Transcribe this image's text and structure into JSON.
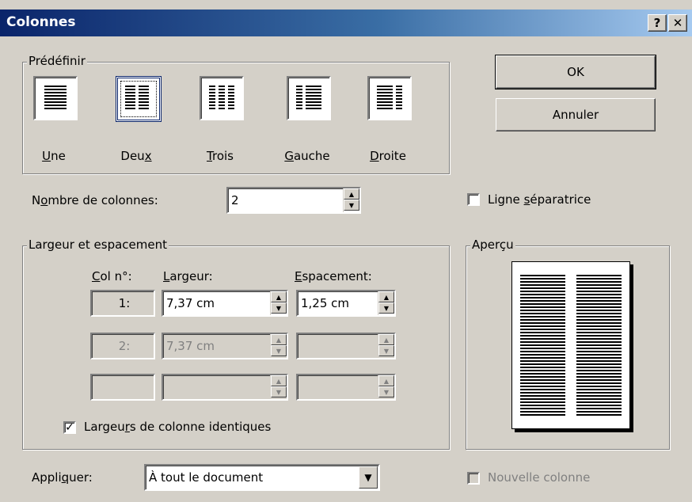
{
  "window": {
    "title": "Colonnes",
    "help_label": "?",
    "close_label": "✕"
  },
  "presets": {
    "group_label": "Prédéfinir",
    "items": [
      {
        "key": "U",
        "rest": "ne"
      },
      {
        "pre": "Deu",
        "key": "x",
        "rest": ""
      },
      {
        "key": "T",
        "rest": "rois"
      },
      {
        "key": "G",
        "rest": "auche"
      },
      {
        "key": "D",
        "rest": "roite"
      }
    ],
    "selected": "Deux"
  },
  "buttons": {
    "ok": "OK",
    "cancel": "Annuler"
  },
  "nombre": {
    "pre": "N",
    "key": "o",
    "rest": "mbre de colonnes:",
    "value": "2"
  },
  "separator": {
    "pre": "Ligne ",
    "key": "s",
    "rest": "éparatrice",
    "checked": false
  },
  "width_group": {
    "label": "Largeur et espacement",
    "col_header": {
      "key": "C",
      "rest": "ol n°:"
    },
    "width_header": {
      "key": "L",
      "rest": "argeur:"
    },
    "spacing_header": {
      "key": "E",
      "rest": "spacement:"
    },
    "rows": [
      {
        "col": "1:",
        "width": "7,37 cm",
        "spacing": "1,25 cm",
        "enabled": true
      },
      {
        "col": "2:",
        "width": "7,37 cm",
        "spacing": "",
        "enabled": false
      },
      {
        "col": "",
        "width": "",
        "spacing": "",
        "enabled": false
      }
    ],
    "equal": {
      "pre": "Largeu",
      "key": "r",
      "rest": "s de colonne identiques",
      "checked": true
    }
  },
  "preview": {
    "label": "Aperçu",
    "columns": 2
  },
  "apply": {
    "pre": "Appli",
    "key": "q",
    "rest": "uer:",
    "value": "À tout le document"
  },
  "new_column": {
    "label": "Nouvelle colonne",
    "checked": false,
    "enabled": false
  }
}
